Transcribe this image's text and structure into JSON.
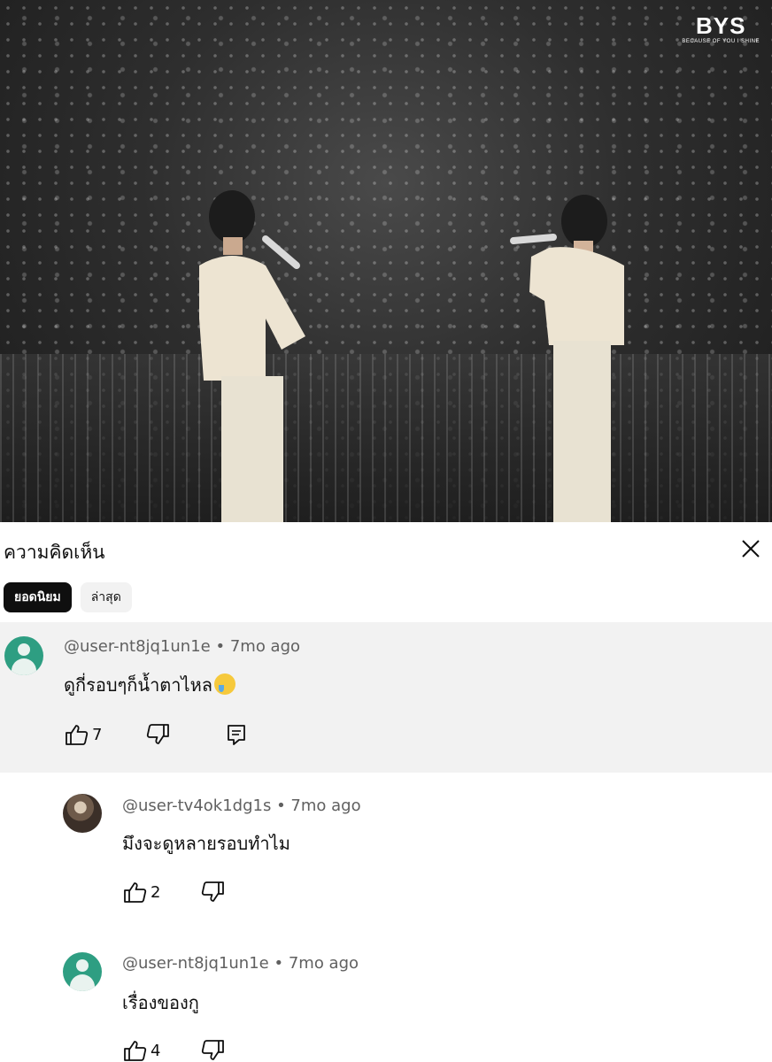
{
  "video": {
    "logo": "BYS",
    "logo_tagline": "BECAUSE OF YOU I SHINE"
  },
  "panel": {
    "title": "ความคิดเห็น",
    "close_icon": "close-icon",
    "chips": [
      {
        "label": "ยอดนิยม",
        "active": true
      },
      {
        "label": "ล่าสุด",
        "active": false
      }
    ]
  },
  "comments": [
    {
      "author": "@user-nt8jq1un1e",
      "time": "7mo ago",
      "text": "ดูกี่รอบๆก็น้ำตาไหล",
      "emoji": "crying-face",
      "likes": "7",
      "avatar": "default-avatar-green"
    }
  ],
  "replies": [
    {
      "author": "@user-tv4ok1dg1s",
      "time": "7mo ago",
      "text": "มึงจะดูหลายรอบทำไม",
      "likes": "2",
      "avatar": "photo-avatar"
    },
    {
      "author": "@user-nt8jq1un1e",
      "time": "7mo ago",
      "text": "เรื่องของกู",
      "likes": "4",
      "avatar": "default-avatar-green"
    }
  ]
}
